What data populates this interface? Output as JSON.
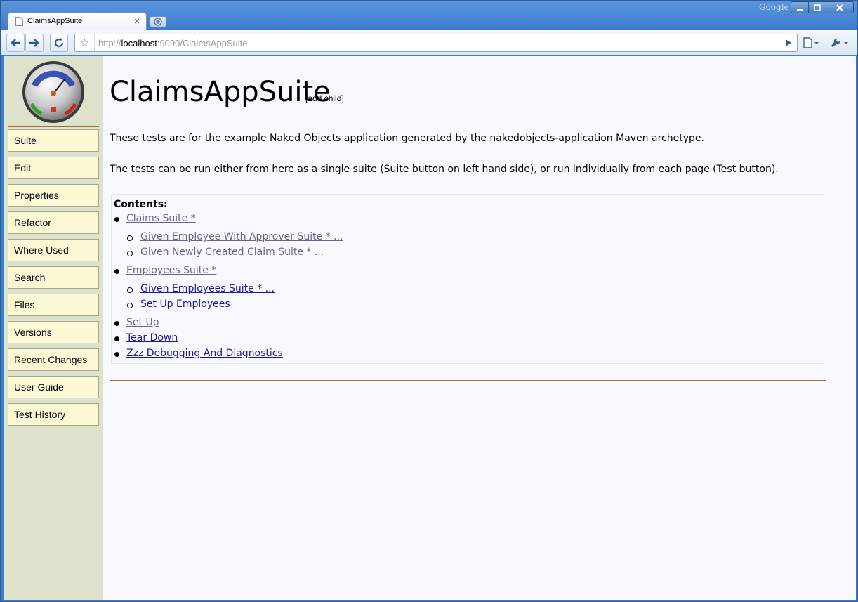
{
  "browser": {
    "tab_title": "ClaimsAppSuite",
    "tab_close": "×",
    "brand": "Google",
    "url_scheme": "http://",
    "url_host": "localhost",
    "url_rest": ":9090/ClaimsAppSuite"
  },
  "sidebar": {
    "items": [
      {
        "label": "Suite"
      },
      {
        "label": "Edit"
      },
      {
        "label": "Properties"
      },
      {
        "label": "Refactor"
      },
      {
        "label": "Where Used"
      },
      {
        "label": "Search"
      },
      {
        "label": "Files"
      },
      {
        "label": "Versions"
      },
      {
        "label": "Recent Changes"
      },
      {
        "label": "User Guide"
      },
      {
        "label": "Test History"
      }
    ]
  },
  "page": {
    "title": "ClaimsAppSuite",
    "add_child": "[add child]",
    "para1": "These tests are for the example Naked Objects application generated by the nakedobjects-application Maven archetype.",
    "para2": "The tests can be run either from here as a single suite (Suite button on left hand side), or run individually from each page (Test button).",
    "contents_title": "Contents:",
    "contents": [
      {
        "label": "Claims Suite *",
        "level": 1,
        "visited": true
      },
      {
        "label": "Given Employee With Approver Suite * ...",
        "level": 2,
        "visited": true
      },
      {
        "label": "Given Newly Created Claim Suite * ...",
        "level": 2,
        "visited": true
      },
      {
        "label": "Employees Suite *",
        "level": 1,
        "visited": true
      },
      {
        "label": "Given Employees Suite * ...",
        "level": 2,
        "visited": false
      },
      {
        "label": "Set Up Employees",
        "level": 2,
        "visited": false
      },
      {
        "label": "Set Up",
        "level": 1,
        "visited": true
      },
      {
        "label": "Tear Down",
        "level": 1,
        "visited": false
      },
      {
        "label": "Zzz Debugging And Diagnostics",
        "level": 1,
        "visited": false
      }
    ]
  },
  "colors": {
    "sidebar_bg": "#dde2cc",
    "nav_button_bg": "#fcf8d6",
    "rule": "#a0723e",
    "link": "#1a1a99",
    "visited_link": "#66668a"
  }
}
